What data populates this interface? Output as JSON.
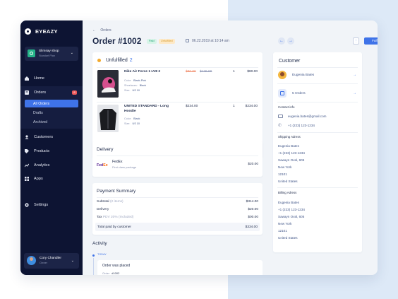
{
  "app": {
    "brand": "EYEAZY"
  },
  "shop": {
    "name": "Slimsay shop",
    "plan": "Standart Plan"
  },
  "nav": {
    "home": "Home",
    "orders": "Orders",
    "orders_badge": "8",
    "orders_sub": [
      "All Orders",
      "Drafts",
      "Archived"
    ],
    "customers": "Customers",
    "products": "Products",
    "analytics": "Analytics",
    "apps": "Apps",
    "settings": "Settings"
  },
  "user": {
    "name": "Cory Chandler",
    "role": "Owner"
  },
  "header": {
    "breadcrumb": "Orders",
    "title": "Order #1002",
    "status_paid": "Paid",
    "status_fulfillment": "Unfulfilled",
    "date": "06.22.2019 at 10:14 am",
    "more": "⋮",
    "fulfill_button": "Fulfill"
  },
  "unfulfilled": {
    "title": "Unfulfilled",
    "count": "2",
    "items": [
      {
        "name": "Nike Air Force 1 LV8 2",
        "attrs": [
          {
            "label": "Color:",
            "value": "Black-Pink"
          },
          {
            "label": "Shoelaces:",
            "value": "Black"
          },
          {
            "label": "Size:",
            "value": "US 10"
          }
        ],
        "price_sale": "$80.00",
        "price_old": "$136.00",
        "qty": "1",
        "total": "$80.00"
      },
      {
        "name": "UNITED STANDARD - Long Hoodie",
        "attrs": [
          {
            "label": "Color:",
            "value": "Black"
          },
          {
            "label": "Size:",
            "value": "US 10"
          }
        ],
        "price": "$234.00",
        "qty": "1",
        "total": "$234.00"
      }
    ]
  },
  "delivery": {
    "title": "Delivery",
    "carrier": "FedEx",
    "service": "First class package",
    "price": "$20.00",
    "logo_fe": "Fed",
    "logo_ex": "Ex"
  },
  "payment": {
    "title": "Payment Summary",
    "subtotal_label": "Subtotal",
    "subtotal_items": "(2 items)",
    "subtotal": "$314.00",
    "delivery_label": "Delivery",
    "delivery": "$20.00",
    "tax_label": "Tax",
    "tax_note": "PDV 20% (Included)",
    "tax": "$00.00",
    "total_label": "Total paid by customer",
    "total": "$334.00"
  },
  "activity": {
    "title": "Activity",
    "today": "TODAY",
    "event": "Order was placed",
    "order_label": "Order",
    "order_value": "#1002"
  },
  "customer": {
    "title": "Customer",
    "name": "Eugenia Bates",
    "orders": "5 Orders",
    "contact_title": "Contact info",
    "email": "eugenia.bates@gmail.com",
    "phone": "+1 (223) 123-1234",
    "shipping_title": "Shipping Adress",
    "shipping": [
      "Eugenia Bates",
      "+1 (223) 123-1234",
      "Sawayn Oval, 605",
      "New York",
      "12101",
      "United States"
    ],
    "billing_title": "Billing Adress",
    "billing": [
      "Eugenia Bates",
      "+1 (223) 123-1234",
      "Sawayn Oval, 605",
      "New York",
      "12101",
      "United States"
    ]
  },
  "colors": {
    "accent": "#3f73e8",
    "sidebar": "#0d1433",
    "paid": "#1fa476",
    "unfulfilled": "#d79a2a"
  }
}
